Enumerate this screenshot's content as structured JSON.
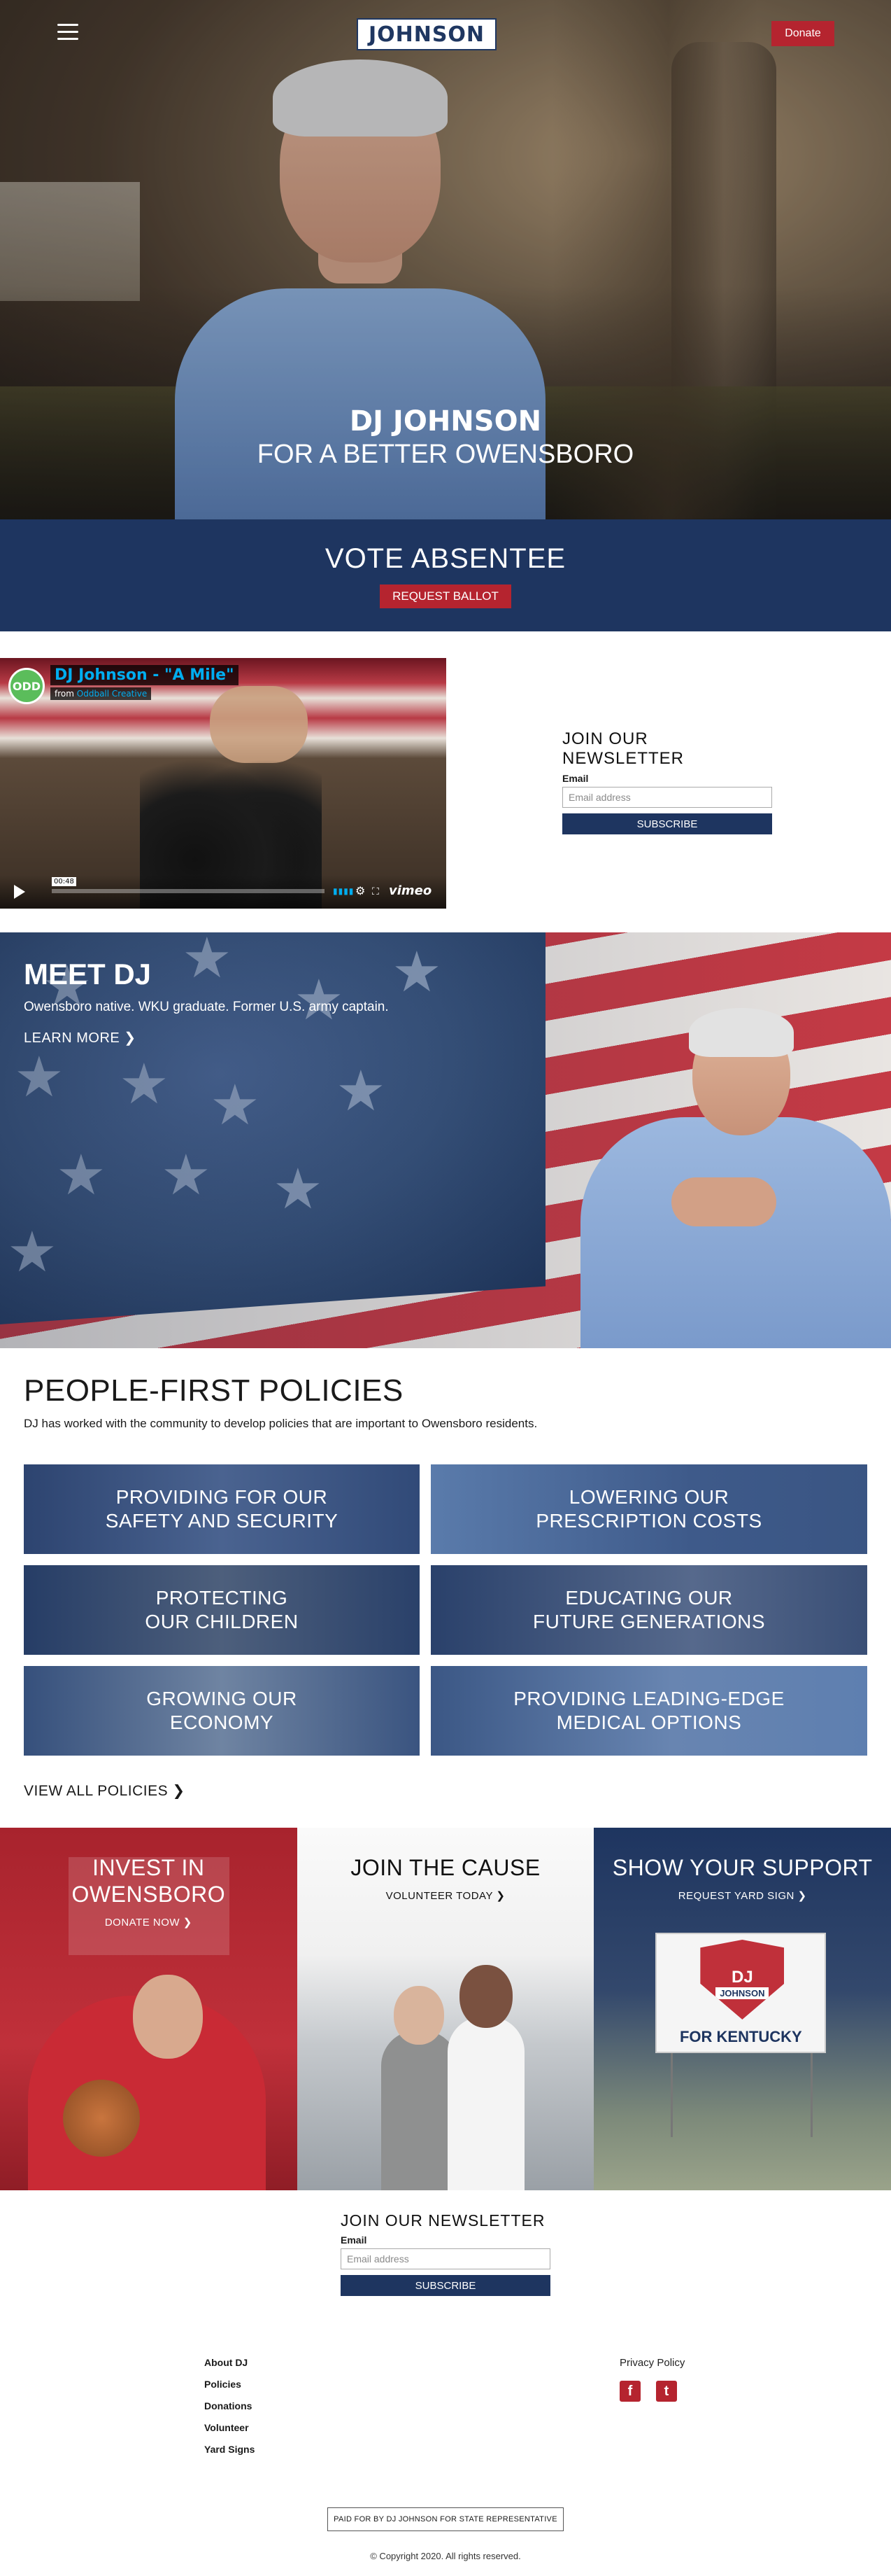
{
  "header": {
    "logo": "JOHNSON",
    "donate_label": "Donate"
  },
  "hero": {
    "name": "DJ JOHNSON",
    "tagline": "FOR A BETTER OWENSBORO"
  },
  "vote": {
    "title": "VOTE ABSENTEE",
    "button": "REQUEST BALLOT"
  },
  "video": {
    "badge": "ODD",
    "title": "DJ Johnson - \"A Mile\"",
    "from_prefix": "from",
    "from_name": "Oddball Creative",
    "time": "00:48",
    "brand": "vimeo"
  },
  "newsletter": {
    "title": "JOIN OUR NEWSLETTER",
    "label": "Email",
    "placeholder": "Email address",
    "button": "SUBSCRIBE"
  },
  "meet": {
    "title": "MEET DJ",
    "text": "Owensboro native. WKU graduate. Former U.S. army captain.",
    "link": "LEARN MORE"
  },
  "policies": {
    "title": "PEOPLE-FIRST POLICIES",
    "intro": "DJ has worked with the community to develop policies that are important to Owensboro residents.",
    "tiles": [
      {
        "line1": "PROVIDING FOR OUR",
        "line2": "SAFETY AND SECURITY"
      },
      {
        "line1": "LOWERING OUR",
        "line2": "PRESCRIPTION COSTS"
      },
      {
        "line1": "PROTECTING",
        "line2": "OUR CHILDREN"
      },
      {
        "line1": "EDUCATING OUR",
        "line2": "FUTURE GENERATIONS"
      },
      {
        "line1": "GROWING OUR",
        "line2": "ECONOMY"
      },
      {
        "line1": "PROVIDING LEADING-EDGE",
        "line2": "MEDICAL OPTIONS"
      }
    ],
    "view_all": "VIEW ALL POLICIES"
  },
  "cta": {
    "invest": {
      "line1": "INVEST IN",
      "line2": "OWENSBORO",
      "link": "DONATE NOW"
    },
    "join": {
      "title": "JOIN THE CAUSE",
      "link": "VOLUNTEER TODAY"
    },
    "support": {
      "title": "SHOW YOUR SUPPORT",
      "link": "REQUEST YARD SIGN",
      "sign_dj": "DJ",
      "sign_name": "JOHNSON",
      "sign_footer": "FOR KENTUCKY"
    }
  },
  "newsletter2": {
    "title": "JOIN OUR NEWSLETTER",
    "label": "Email",
    "placeholder": "Email address",
    "button": "SUBSCRIBE"
  },
  "footer": {
    "links": [
      "About DJ",
      "Policies",
      "Donations",
      "Volunteer",
      "Yard Signs"
    ],
    "privacy": "Privacy Policy",
    "social": [
      "f",
      "t"
    ],
    "paid_for": "PAID FOR BY DJ JOHNSON FOR STATE REPRESENTATIVE",
    "copyright": "© Copyright 2020. All rights reserved."
  },
  "colors": {
    "navy": "#1e3560",
    "red": "#b5242f"
  }
}
